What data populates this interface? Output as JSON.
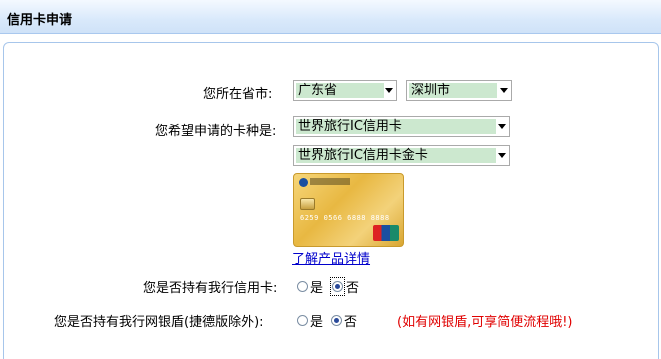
{
  "header": {
    "title": "信用卡申请"
  },
  "location": {
    "label": "您所在省市:",
    "province": "广东省",
    "city": "深圳市"
  },
  "card_type": {
    "label": "您希望申请的卡种是:",
    "series": "世界旅行IC信用卡",
    "level": "世界旅行IC信用卡金卡",
    "card_number_text": "6259 0566 6888 8888",
    "detail_link": "了解产品详情"
  },
  "has_credit_card": {
    "label": "您是否持有我行信用卡:",
    "options": [
      "是",
      "否"
    ],
    "selected": "否"
  },
  "has_usb_key": {
    "label": "您是否持有我行网银盾(捷德版除外):",
    "options": [
      "是",
      "否"
    ],
    "selected": "否",
    "hint": "(如有网银盾,可享简便流程哦!)"
  },
  "colors": {
    "accent": "#a7c6eb",
    "select_highlight": "#cce8cf",
    "hint": "#e00000",
    "link": "#0000cc"
  }
}
